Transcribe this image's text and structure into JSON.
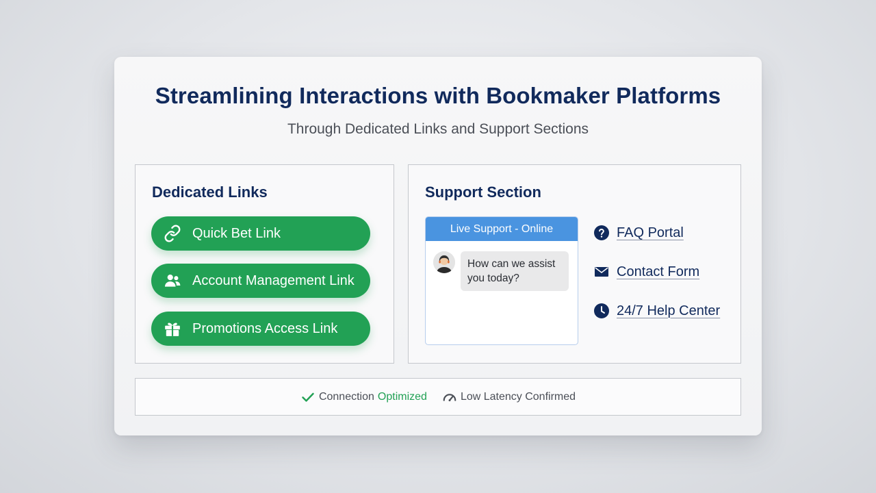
{
  "header": {
    "title": "Streamlining Interactions with Bookmaker Platforms",
    "subtitle": "Through Dedicated Links and Support Sections"
  },
  "dedicated_links": {
    "heading": "Dedicated Links",
    "buttons": [
      {
        "label": "Quick Bet Link",
        "icon": "link-icon"
      },
      {
        "label": "Account Management Link",
        "icon": "users-icon"
      },
      {
        "label": "Promotions Access Link",
        "icon": "gift-icon"
      }
    ],
    "button_color": "#22a155"
  },
  "support": {
    "heading": "Support Section",
    "chat": {
      "header": "Live Support - Online",
      "message": "How can we assist you today?",
      "header_color": "#4a94e0"
    },
    "links": [
      {
        "label": "FAQ Portal",
        "icon": "question-circle-icon"
      },
      {
        "label": "Contact Form",
        "icon": "envelope-icon"
      },
      {
        "label": "24/7 Help Center",
        "icon": "clock-icon"
      }
    ]
  },
  "status": {
    "connection_prefix": "Connection",
    "connection_state": "Optimized",
    "latency": "Low Latency Confirmed",
    "success_color": "#22a155"
  },
  "colors": {
    "navy": "#112a5c",
    "accent_green": "#22a155",
    "accent_blue": "#4a94e0"
  }
}
